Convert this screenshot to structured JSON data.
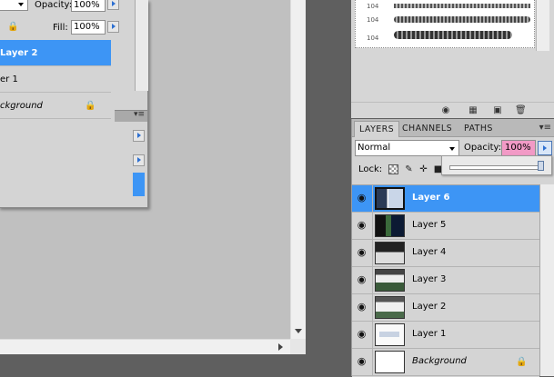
{
  "floating_panel": {
    "blend_mode_value": "",
    "opacity_label": "Opacity:",
    "opacity_value": "100%",
    "fill_label": "Fill:",
    "fill_value": "100%",
    "layers": [
      {
        "name": "Layer 2",
        "selected": true
      },
      {
        "name": "er 1",
        "selected": false
      },
      {
        "name": "ckground",
        "selected": false,
        "italic": true,
        "locked": true
      }
    ]
  },
  "brushes_panel": {
    "brush_sizes": [
      "104",
      "104",
      "104"
    ]
  },
  "layers_panel": {
    "tabs": [
      {
        "label": "LAYERS",
        "active": true
      },
      {
        "label": "CHANNELS",
        "active": false
      },
      {
        "label": "PATHS",
        "active": false
      }
    ],
    "blend_mode": "Normal",
    "opacity_label": "Opacity:",
    "opacity_value": "100%",
    "opacity_percent": 100,
    "lock_label": "Lock:",
    "layers": [
      {
        "name": "Layer 6",
        "selected": true
      },
      {
        "name": "Layer 5",
        "selected": false
      },
      {
        "name": "Layer 4",
        "selected": false
      },
      {
        "name": "Layer 3",
        "selected": false
      },
      {
        "name": "Layer 2",
        "selected": false
      },
      {
        "name": "Layer 1",
        "selected": false
      },
      {
        "name": "Background",
        "selected": false,
        "italic": true,
        "locked": true
      }
    ]
  },
  "colors": {
    "selection": "#3d95f5",
    "opacity_highlight": "#f29ac6",
    "panel": "#d4d4d4",
    "canvas": "#c0c0c0"
  }
}
